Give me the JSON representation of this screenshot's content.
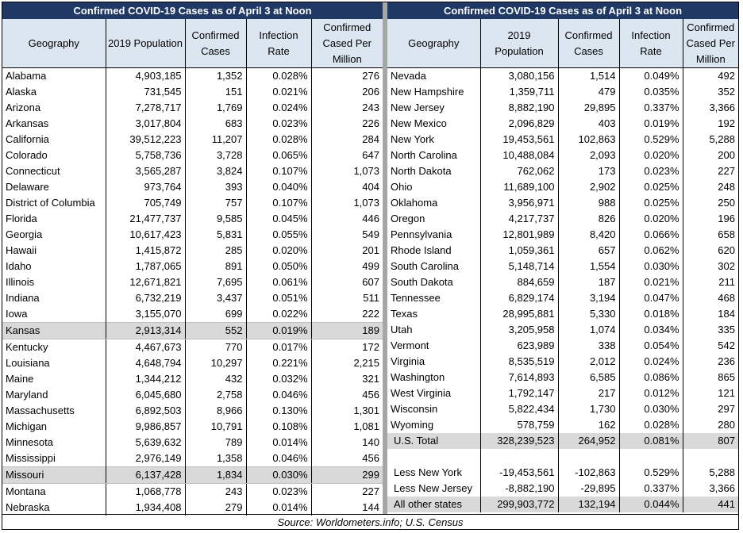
{
  "left": {
    "title": "Confirmed COVID-19 Cases as of April 3 at Noon",
    "headers": [
      "Geography",
      "2019 Population",
      "Confirmed Cases",
      "Infection Rate",
      "Confirmed Cased Per Million"
    ],
    "rows": [
      [
        "Alabama",
        "4,903,185",
        "1,352",
        "0.028%",
        "276"
      ],
      [
        "Alaska",
        "731,545",
        "151",
        "0.021%",
        "206"
      ],
      [
        "Arizona",
        "7,278,717",
        "1,769",
        "0.024%",
        "243"
      ],
      [
        "Arkansas",
        "3,017,804",
        "683",
        "0.023%",
        "226"
      ],
      [
        "California",
        "39,512,223",
        "11,207",
        "0.028%",
        "284"
      ],
      [
        "Colorado",
        "5,758,736",
        "3,728",
        "0.065%",
        "647"
      ],
      [
        "Connecticut",
        "3,565,287",
        "3,824",
        "0.107%",
        "1,073"
      ],
      [
        "Delaware",
        "973,764",
        "393",
        "0.040%",
        "404"
      ],
      [
        "District of Columbia",
        "705,749",
        "757",
        "0.107%",
        "1,073"
      ],
      [
        "Florida",
        "21,477,737",
        "9,585",
        "0.045%",
        "446"
      ],
      [
        "Georgia",
        "10,617,423",
        "5,831",
        "0.055%",
        "549"
      ],
      [
        "Hawaii",
        "1,415,872",
        "285",
        "0.020%",
        "201"
      ],
      [
        "Idaho",
        "1,787,065",
        "891",
        "0.050%",
        "499"
      ],
      [
        "Illinois",
        "12,671,821",
        "7,695",
        "0.061%",
        "607"
      ],
      [
        "Indiana",
        "6,732,219",
        "3,437",
        "0.051%",
        "511"
      ],
      [
        "Iowa",
        "3,155,070",
        "699",
        "0.022%",
        "222"
      ],
      [
        "Kansas",
        "2,913,314",
        "552",
        "0.019%",
        "189"
      ],
      [
        "Kentucky",
        "4,467,673",
        "770",
        "0.017%",
        "172"
      ],
      [
        "Louisiana",
        "4,648,794",
        "10,297",
        "0.221%",
        "2,215"
      ],
      [
        "Maine",
        "1,344,212",
        "432",
        "0.032%",
        "321"
      ],
      [
        "Maryland",
        "6,045,680",
        "2,758",
        "0.046%",
        "456"
      ],
      [
        "Massachusetts",
        "6,892,503",
        "8,966",
        "0.130%",
        "1,301"
      ],
      [
        "Michigan",
        "9,986,857",
        "10,791",
        "0.108%",
        "1,081"
      ],
      [
        "Minnesota",
        "5,639,632",
        "789",
        "0.014%",
        "140"
      ],
      [
        "Mississippi",
        "2,976,149",
        "1,358",
        "0.046%",
        "456"
      ],
      [
        "Missouri",
        "6,137,428",
        "1,834",
        "0.030%",
        "299"
      ],
      [
        "Montana",
        "1,068,778",
        "243",
        "0.023%",
        "227"
      ],
      [
        "Nebraska",
        "1,934,408",
        "279",
        "0.014%",
        "144"
      ]
    ],
    "highlighted": [
      "Kansas",
      "Missouri"
    ]
  },
  "right": {
    "title": "Confirmed COVID-19 Cases as of April 3 at Noon",
    "headers": [
      "Geography",
      "2019 Population",
      "Confirmed Cases",
      "Infection Rate",
      "Confirmed Cased Per Million"
    ],
    "rows": [
      [
        "Nevada",
        "3,080,156",
        "1,514",
        "0.049%",
        "492"
      ],
      [
        "New Hampshire",
        "1,359,711",
        "479",
        "0.035%",
        "352"
      ],
      [
        "New Jersey",
        "8,882,190",
        "29,895",
        "0.337%",
        "3,366"
      ],
      [
        "New Mexico",
        "2,096,829",
        "403",
        "0.019%",
        "192"
      ],
      [
        "New York",
        "19,453,561",
        "102,863",
        "0.529%",
        "5,288"
      ],
      [
        "North Carolina",
        "10,488,084",
        "2,093",
        "0.020%",
        "200"
      ],
      [
        "North Dakota",
        "762,062",
        "173",
        "0.023%",
        "227"
      ],
      [
        "Ohio",
        "11,689,100",
        "2,902",
        "0.025%",
        "248"
      ],
      [
        "Oklahoma",
        "3,956,971",
        "988",
        "0.025%",
        "250"
      ],
      [
        "Oregon",
        "4,217,737",
        "826",
        "0.020%",
        "196"
      ],
      [
        "Pennsylvania",
        "12,801,989",
        "8,420",
        "0.066%",
        "658"
      ],
      [
        "Rhode Island",
        "1,059,361",
        "657",
        "0.062%",
        "620"
      ],
      [
        "South Carolina",
        "5,148,714",
        "1,554",
        "0.030%",
        "302"
      ],
      [
        "South Dakota",
        "884,659",
        "187",
        "0.021%",
        "211"
      ],
      [
        "Tennessee",
        "6,829,174",
        "3,194",
        "0.047%",
        "468"
      ],
      [
        "Texas",
        "28,995,881",
        "5,330",
        "0.018%",
        "184"
      ],
      [
        "Utah",
        "3,205,958",
        "1,074",
        "0.034%",
        "335"
      ],
      [
        "Vermont",
        "623,989",
        "338",
        "0.054%",
        "542"
      ],
      [
        "Virginia",
        "8,535,519",
        "2,012",
        "0.024%",
        "236"
      ],
      [
        "Washington",
        "7,614,893",
        "6,585",
        "0.086%",
        "865"
      ],
      [
        "West Virginia",
        "1,792,147",
        "217",
        "0.012%",
        "121"
      ],
      [
        "Wisconsin",
        "5,822,434",
        "1,730",
        "0.030%",
        "297"
      ],
      [
        "Wyoming",
        "578,759",
        "162",
        "0.028%",
        "280"
      ]
    ],
    "total": [
      "U.S. Total",
      "328,239,523",
      "264,952",
      "0.081%",
      "807"
    ],
    "less_rows": [
      [
        "Less New York",
        "-19,453,561",
        "-102,863",
        "0.529%",
        "5,288"
      ],
      [
        "Less New Jersey",
        "-8,882,190",
        "-29,895",
        "0.337%",
        "3,366"
      ]
    ],
    "other": [
      "All other states",
      "299,903,772",
      "132,194",
      "0.044%",
      "441"
    ]
  },
  "colors": {
    "title_bg": "#1f3864",
    "header_bg": "#dce6f1",
    "highlight_bg": "#d9d9d9",
    "separator": "#a6a6a6"
  },
  "source": "Source: Worldometers.info; U.S. Census"
}
